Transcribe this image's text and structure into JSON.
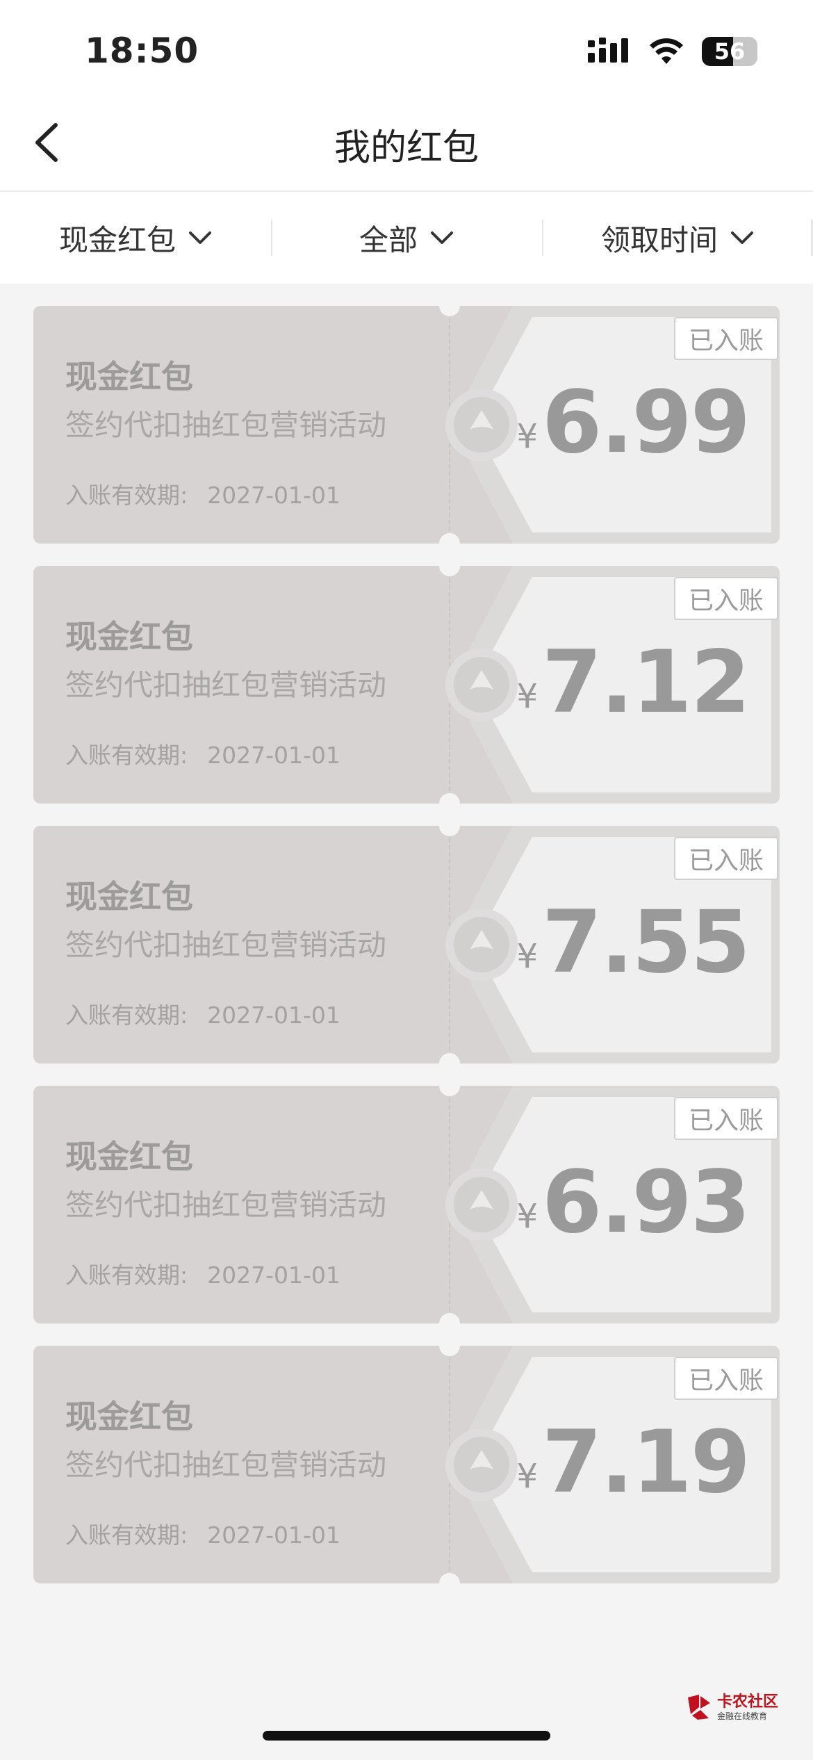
{
  "status_bar": {
    "time": "18:50",
    "battery": "56",
    "battery_level_percent": 56
  },
  "nav": {
    "title": "我的红包"
  },
  "filters": [
    {
      "label": "现金红包"
    },
    {
      "label": "全部"
    },
    {
      "label": "领取时间"
    }
  ],
  "coupons": [
    {
      "title": "现金红包",
      "desc": "签约代扣抽红包营销活动",
      "expiry_label": "入账有效期:",
      "expiry_date": "2027-01-01",
      "currency": "¥",
      "amount": "6.99",
      "status": "已入账"
    },
    {
      "title": "现金红包",
      "desc": "签约代扣抽红包营销活动",
      "expiry_label": "入账有效期:",
      "expiry_date": "2027-01-01",
      "currency": "¥",
      "amount": "7.12",
      "status": "已入账"
    },
    {
      "title": "现金红包",
      "desc": "签约代扣抽红包营销活动",
      "expiry_label": "入账有效期:",
      "expiry_date": "2027-01-01",
      "currency": "¥",
      "amount": "7.55",
      "status": "已入账"
    },
    {
      "title": "现金红包",
      "desc": "签约代扣抽红包营销活动",
      "expiry_label": "入账有效期:",
      "expiry_date": "2027-01-01",
      "currency": "¥",
      "amount": "6.93",
      "status": "已入账"
    },
    {
      "title": "现金红包",
      "desc": "签约代扣抽红包营销活动",
      "expiry_label": "入账有效期:",
      "expiry_date": "2027-01-01",
      "currency": "¥",
      "amount": "7.19",
      "status": "已入账"
    }
  ],
  "watermark": {
    "title": "卡农社区",
    "subtitle": "金融在线教育"
  },
  "colors": {
    "coupon_bg": "#d7d3d3",
    "coupon_right_panel": "#ededed",
    "page_bg": "#f4f4f4",
    "watermark_red": "#c0111f"
  }
}
